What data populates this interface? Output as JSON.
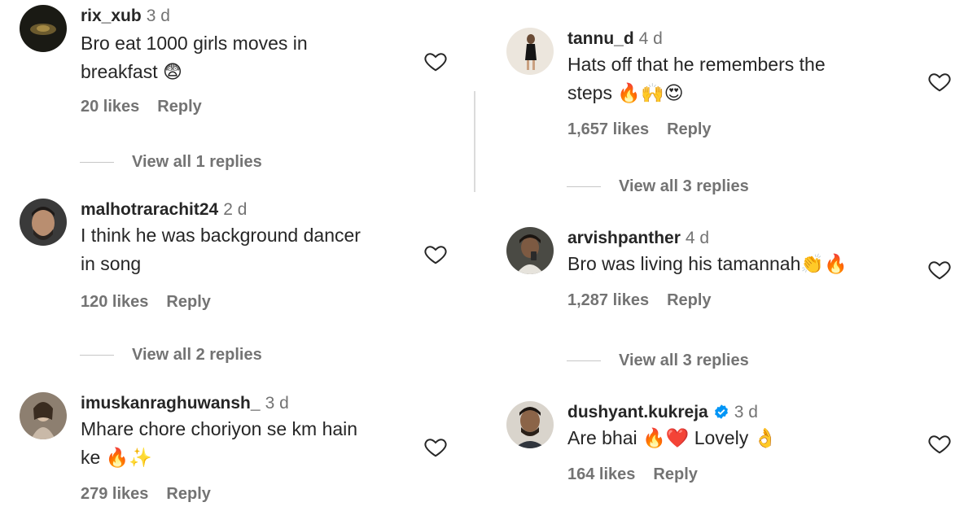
{
  "left_comments": [
    {
      "username": "rix_xub",
      "time": "3 d",
      "text_lines": [
        "Bro eat 1000 girls moves in",
        "breakfast 😨"
      ],
      "likes": "20 likes",
      "reply": "Reply",
      "view_replies": "View all 1 replies"
    },
    {
      "username": "malhotrarachit24",
      "time": "2 d",
      "text_lines": [
        "I think he was background dancer",
        "in song"
      ],
      "likes": "120 likes",
      "reply": "Reply",
      "view_replies": "View all 2 replies"
    },
    {
      "username": "imuskanraghuwansh_",
      "time": "3 d",
      "text_lines": [
        "Mhare chore choriyon se km hain",
        "ke 🔥✨"
      ],
      "likes": "279 likes",
      "reply": "Reply"
    }
  ],
  "right_comments": [
    {
      "username": "tannu_d",
      "time": "4 d",
      "text_lines": [
        "Hats off that he remembers the",
        "steps 🔥🙌😍"
      ],
      "likes": "1,657 likes",
      "reply": "Reply",
      "view_replies": "View all 3 replies"
    },
    {
      "username": "arvishpanther",
      "time": "4 d",
      "text_lines": [
        "Bro was living his tamannah👏🔥"
      ],
      "likes": "1,287 likes",
      "reply": "Reply",
      "view_replies": "View all 3 replies"
    },
    {
      "username": "dushyant.kukreja",
      "time": "3 d",
      "text_lines": [
        "Are bhai 🔥❤️ Lovely 👌"
      ],
      "likes": "164 likes",
      "reply": "Reply"
    }
  ],
  "colors": {
    "text": "#262626",
    "muted": "#737373",
    "verified": "#0095f6"
  },
  "icons": [
    "heart-icon",
    "verified-badge-icon"
  ]
}
